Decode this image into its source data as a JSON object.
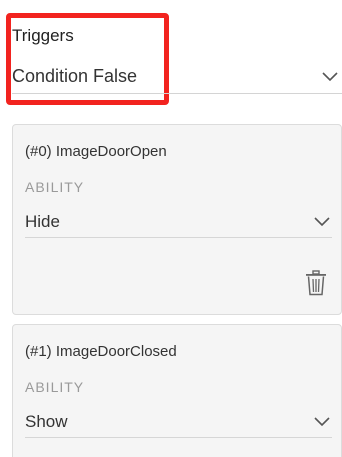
{
  "triggers": {
    "label": "Triggers",
    "selected_condition": "Condition False"
  },
  "actions": [
    {
      "title": "(#0) ImageDoorOpen",
      "ability_label": "ABILITY",
      "ability_value": "Hide",
      "has_delete": true
    },
    {
      "title": "(#1) ImageDoorClosed",
      "ability_label": "ABILITY",
      "ability_value": "Show",
      "has_delete": false
    }
  ],
  "colors": {
    "highlight": "#f2231f",
    "card_background": "#f5f5f5",
    "muted_label": "#9a9a9a",
    "text": "#333333"
  },
  "icons": {
    "dropdown": "chevron-down-icon",
    "delete": "trash-icon"
  }
}
